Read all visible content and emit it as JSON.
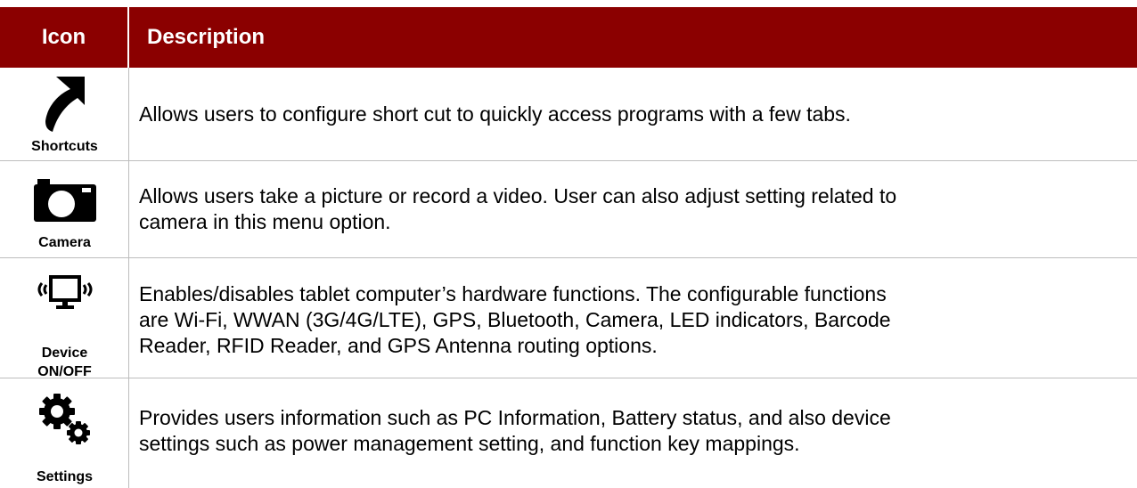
{
  "table": {
    "header": {
      "icon": "Icon",
      "description": "Description"
    },
    "rows": [
      {
        "icon": "shortcut-arrow-icon",
        "label": "Shortcuts",
        "description": "Allows users to configure short cut to quickly access programs with a few tabs."
      },
      {
        "icon": "camera-icon",
        "label": "Camera",
        "description_lines": [
          "Allows users take a picture or record a video. User can also adjust setting related to",
          "camera in this menu option."
        ]
      },
      {
        "icon": "device-monitor-icon",
        "label_lines": [
          "Device",
          "ON/OFF"
        ],
        "description_lines": [
          "Enables/disables tablet computer’s hardware functions. The configurable functions",
          "are Wi-Fi, WWAN (3G/4G/LTE), GPS, Bluetooth, Camera, LED indicators, Barcode",
          "Reader, RFID Reader, and GPS Antenna routing options."
        ]
      },
      {
        "icon": "settings-gears-icon",
        "label": "Settings",
        "description_lines": [
          "Provides users information such as PC Information, Battery status, and also device",
          "settings such as power management setting, and function key mappings."
        ]
      }
    ],
    "colors": {
      "header_bg": "#8b0000",
      "header_text": "#ffffff",
      "border": "#bdbdbd"
    }
  }
}
